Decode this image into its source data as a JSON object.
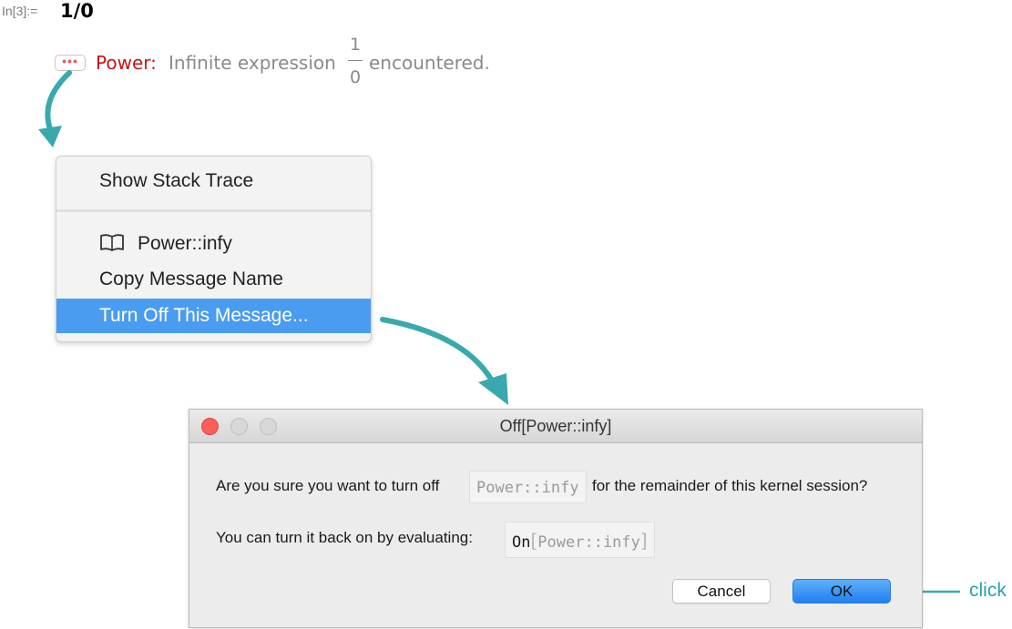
{
  "notebook": {
    "input_label": "In[3]:=",
    "input_expression": "1/0"
  },
  "message": {
    "symbol": "Power:",
    "text_before": "Infinite expression",
    "fraction_numerator": "1",
    "fraction_denominator": "0",
    "text_after": "encountered.",
    "button_dots": "•••"
  },
  "context_menu": {
    "items": [
      {
        "label": "Show Stack Trace"
      },
      {
        "label": "Power::infy",
        "icon": "book-icon"
      },
      {
        "label": "Copy Message Name"
      },
      {
        "label": "Turn Off This Message...",
        "highlighted": true
      }
    ]
  },
  "dialog": {
    "title": "Off[Power::infy]",
    "line1_before": "Are you sure you want to turn off",
    "line1_code": "Power::infy",
    "line1_after": "for the remainder of this kernel session?",
    "line2_before": "You can turn it back on by evaluating:",
    "line2_code_head": "On",
    "line2_code_open": "[",
    "line2_code_arg": "Power::infy",
    "line2_code_close": "]",
    "cancel_label": "Cancel",
    "ok_label": "OK"
  },
  "annotation": {
    "click_label": "click",
    "arrow_color": "#3aa9ad"
  },
  "colors": {
    "message_symbol": "#c81414",
    "menu_highlight": "#4a9cf0",
    "ok_button": "#2080f2",
    "close_button": "#fc5f57"
  }
}
